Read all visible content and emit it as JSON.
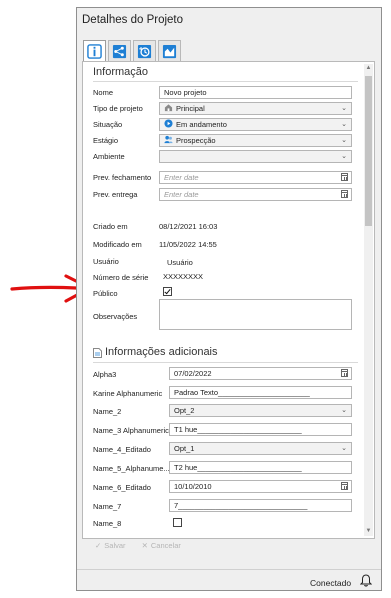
{
  "window": {
    "title": "Detalhes do Projeto"
  },
  "tabs": [
    {
      "name": "info",
      "icon": "info-icon",
      "active": true
    },
    {
      "name": "hierarchy",
      "icon": "hierarchy-icon",
      "active": false
    },
    {
      "name": "history",
      "icon": "history-icon",
      "active": false
    },
    {
      "name": "chart",
      "icon": "chart-icon",
      "active": false
    }
  ],
  "info_section": {
    "title": "Informação",
    "nome_label": "Nome",
    "nome_value": "Novo projeto",
    "tipo_label": "Tipo de projeto",
    "tipo_value": "Principal",
    "situacao_label": "Situação",
    "situacao_value": "Em andamento",
    "estagio_label": "Estágio",
    "estagio_value": "Prospecção",
    "ambiente_label": "Ambiente",
    "ambiente_value": "",
    "fechamento_label": "Prev. fechamento",
    "fechamento_placeholder": "Enter date",
    "entrega_label": "Prev. entrega",
    "entrega_placeholder": "Enter date",
    "criado_label": "Criado em",
    "criado_value": "08/12/2021 16:03",
    "modificado_label": "Modificado em",
    "modificado_value": "11/05/2022 14:55",
    "usuario_label": "Usuário",
    "usuario_value": "Usuário",
    "serie_label": "Número de série",
    "serie_value": "XXXXXXXX",
    "publico_label": "Público",
    "publico_checked": true,
    "observacoes_label": "Observações"
  },
  "additional_section": {
    "title": "Informações adicionais",
    "alpha3_label": "Alpha3",
    "alpha3_value": "07/02/2022",
    "karine_label": "Karine Alphanumeric",
    "karine_value": "Padrao Texto______________________",
    "name2_label": "Name_2",
    "name2_value": "Opt_2",
    "name3_label": "Name_3 Alphanumeric",
    "name3_value": "T1 hue_________________________",
    "name4_label": "Name_4_Editado",
    "name4_value": "Opt_1",
    "name5_label": "Name_5_Alphanume...",
    "name5_value": "T2 hue_________________________",
    "name6_label": "Name_6_Editado",
    "name6_value": "10/10/2010",
    "name7_label": "Name_7",
    "name7_value": "7_______________________________",
    "name8_label": "Name_8"
  },
  "actions": {
    "save_label": "Salvar",
    "cancel_label": "Cancelar"
  },
  "status": {
    "text": "Conectado"
  },
  "colors": {
    "accent": "#1e7fd4",
    "arrow": "#e01010",
    "disabled": "#b5b5b5"
  }
}
